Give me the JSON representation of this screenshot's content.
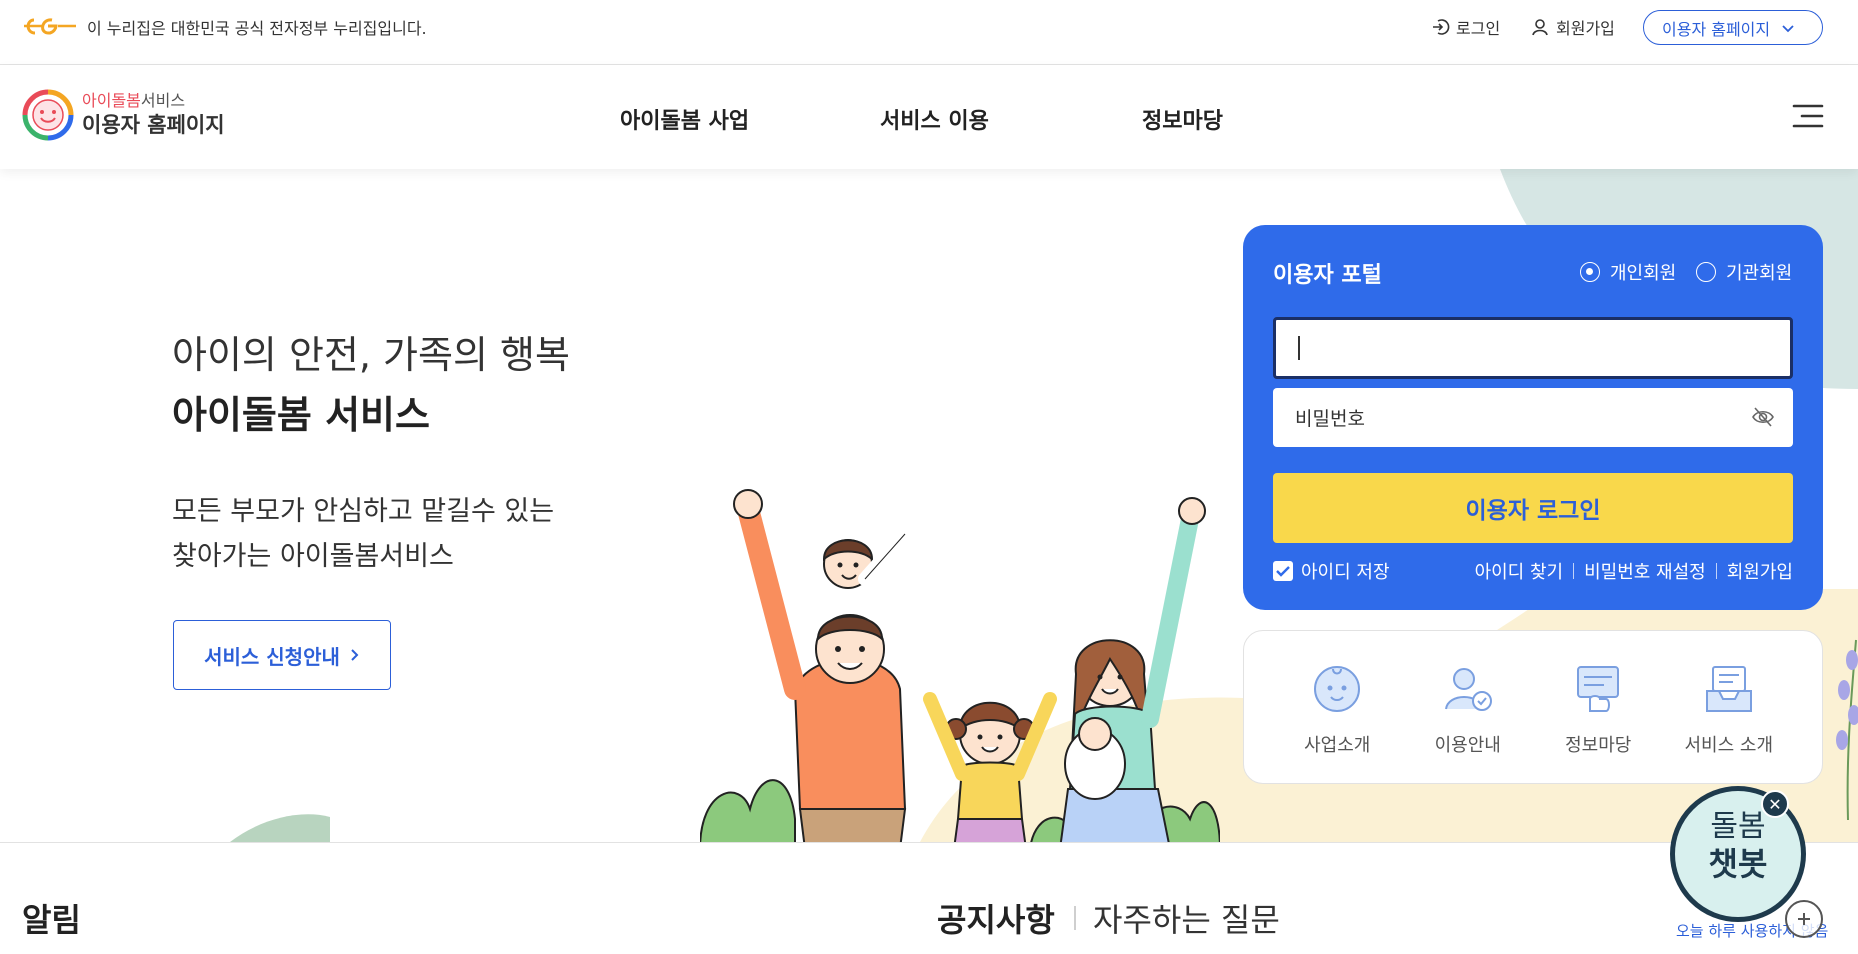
{
  "gov_bar": {
    "notice": "이 누리집은 대한민국 공식 전자정부 누리집입니다.",
    "login": "로그인",
    "signup": "회원가입",
    "site_select": "이용자 홈페이지"
  },
  "header": {
    "brand_sub_highlight": "아이돌봄",
    "brand_sub_rest": "서비스",
    "brand_main": "이용자 홈페이지",
    "nav": [
      "아이돌봄 사업",
      "서비스 이용",
      "정보마당"
    ]
  },
  "hero": {
    "line1": "아이의 안전, 가족의 행복",
    "line2": "아이돌봄 서비스",
    "desc1": "모든 부모가 안심하고 맡길수 있는",
    "desc2": "찾아가는 아이돌봄서비스",
    "button": "서비스 신청안내"
  },
  "portal": {
    "title": "이용자 포털",
    "radio_personal": "개인회원",
    "radio_org": "기관회원",
    "selected_type": "개인회원",
    "id_value": "",
    "pw_placeholder": "비밀번호",
    "login_button": "이용자 로그인",
    "save_id": "아이디 저장",
    "save_id_checked": true,
    "links": [
      "아이디 찾기",
      "비밀번호 재설정",
      "회원가입"
    ]
  },
  "quick_menu": [
    "사업소개",
    "이용안내",
    "정보마당",
    "서비스 소개"
  ],
  "bottom": {
    "alarm_title": "알림",
    "tab_notice": "공지사항",
    "tab_faq": "자주하는 질문"
  },
  "chatbot": {
    "line1": "돌봄",
    "line2": "챗봇",
    "hide_today": "오늘 하루 사용하지 않음"
  },
  "colors": {
    "primary_blue": "#2f6bea",
    "login_yellow": "#f9d84b",
    "link_blue": "#2c5fd8"
  }
}
